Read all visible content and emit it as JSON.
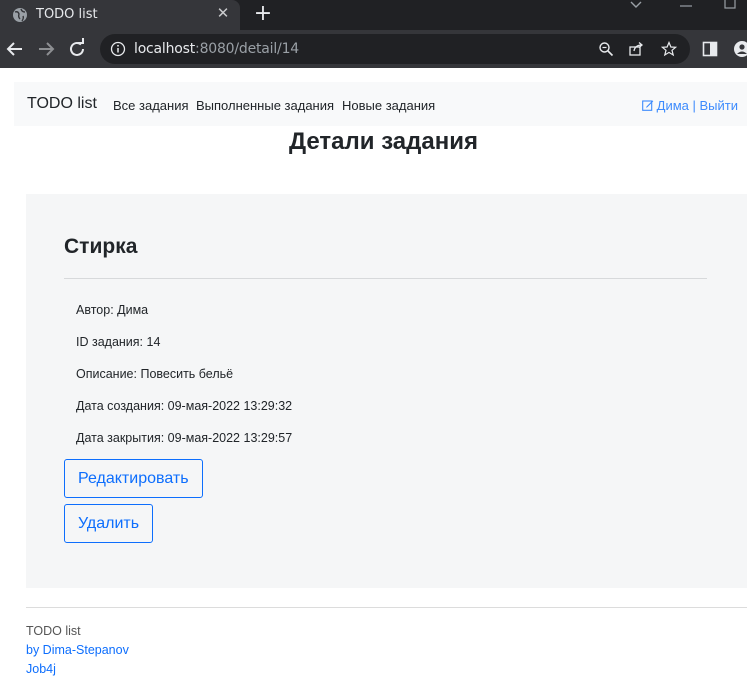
{
  "browser": {
    "tab_title": "TODO list",
    "tab_close": "✕",
    "new_tab": "+",
    "url_host": "localhost",
    "url_rest": ":8080/detail/14"
  },
  "navbar": {
    "brand": "TODO list",
    "links": [
      "Все задания",
      "Выполненные задания",
      "Новые задания"
    ],
    "user": "Дима | Выйти"
  },
  "page_title": "Детали задания",
  "task": {
    "name": "Стирка",
    "author": "Автор: Дима",
    "id": "ID задания: 14",
    "description": "Описание: Повесить бельё",
    "created": "Дата создания: 09-мая-2022 13:29:32",
    "closed": "Дата закрытия: 09-мая-2022 13:29:57",
    "edit_label": "Редактировать",
    "delete_label": "Удалить"
  },
  "footer": {
    "app": "TODO list",
    "author": "by Dima-Stepanov",
    "org": "Job4j"
  },
  "colors": {
    "primary": "#0d6efd",
    "link": "#3d8bfd",
    "navbar_bg": "#f8f9fa",
    "card_bg": "#f5f6f7"
  }
}
